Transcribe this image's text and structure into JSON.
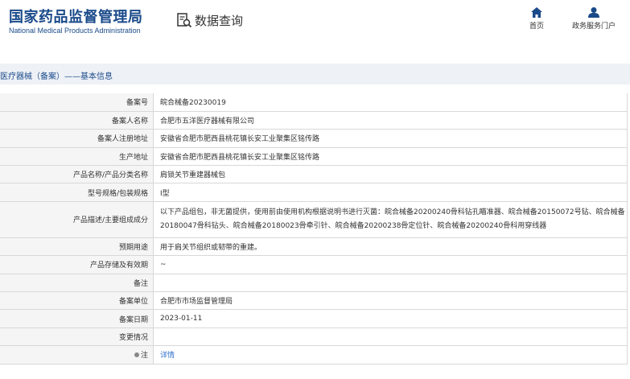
{
  "header": {
    "logo_cn": "国家药品监督管理局",
    "logo_en": "National Medical Products Administration",
    "query_label": "数据查询",
    "nav": [
      {
        "label": "首页",
        "icon": "home-icon"
      },
      {
        "label": "政务服务门户",
        "icon": "user-icon"
      }
    ],
    "accent_color": "#1a4a8a"
  },
  "section": {
    "title": "医疗器械（备案）——基本信息"
  },
  "rows": [
    {
      "key": "备案号",
      "value": "皖合械备20230019"
    },
    {
      "key": "备案人名称",
      "value": "合肥市五洋医疗器械有限公司"
    },
    {
      "key": "备案人注册地址",
      "value": "安徽省合肥市肥西县桃花镇长安工业聚集区铭传路"
    },
    {
      "key": "生产地址",
      "value": "安徽省合肥市肥西县桃花镇长安工业聚集区铭传路"
    },
    {
      "key": "产品名称/产品分类名称",
      "value": "肩锁关节重建器械包"
    },
    {
      "key": "型号规格/包装规格",
      "value": "I型"
    },
    {
      "key": "产品描述/主要组成成分",
      "value": "以下产品组包，非无菌提供，使用前由使用机构根据说明书进行灭菌：皖合械备20200240骨科钻孔瞄准器、皖合械备20150072号钻、皖合械备20180047骨科钻头、皖合械备20180023骨牵引针、皖合械备20200238骨定位针、皖合械备20200240骨科用穿线器"
    },
    {
      "key": "预期用途",
      "value": "用于肩关节组织或韧带的重建。"
    },
    {
      "key": "产品存储及有效期",
      "value": "~"
    },
    {
      "key": "备注",
      "value": ""
    },
    {
      "key": "备案单位",
      "value": "合肥市市场监督管理局"
    },
    {
      "key": "备案日期",
      "value": "2023-01-11"
    },
    {
      "key": "变更情况",
      "value": ""
    },
    {
      "key": "注",
      "value": "详情"
    }
  ]
}
